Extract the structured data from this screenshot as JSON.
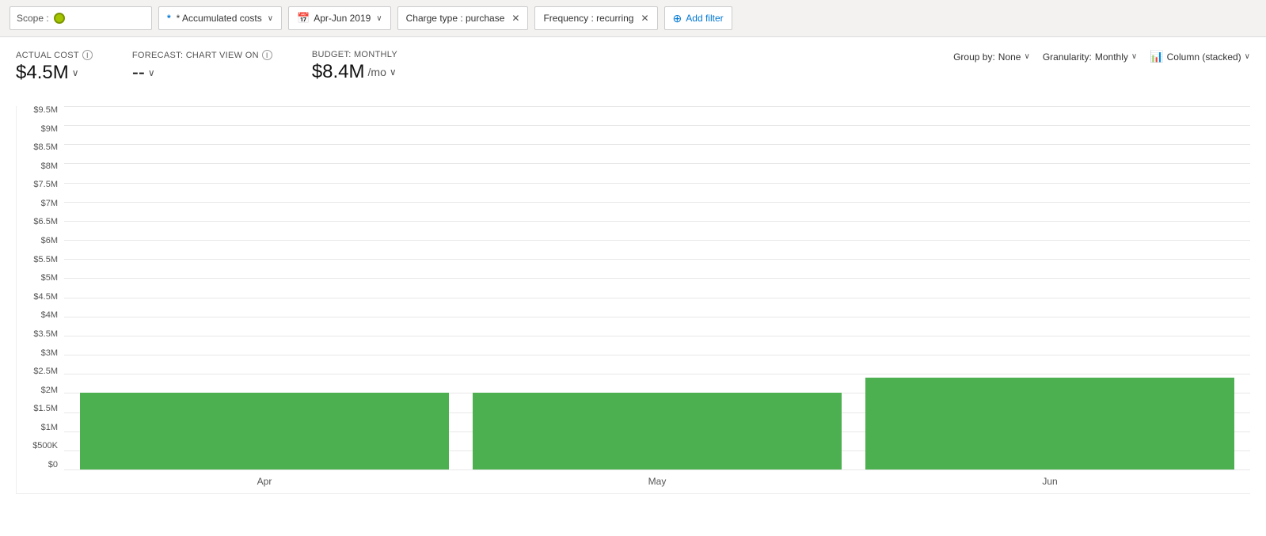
{
  "toolbar": {
    "scope_label": "Scope :",
    "scope_value": "",
    "accumulated_costs_label": "* Accumulated costs",
    "date_range_label": "Apr-Jun 2019",
    "charge_type_label": "Charge type : purchase",
    "frequency_label": "Frequency : recurring",
    "add_filter_label": "Add filter",
    "calendar_icon": "📅"
  },
  "metrics": {
    "actual_cost": {
      "label": "ACTUAL COST",
      "value": "$4.5M",
      "chevron": "∨"
    },
    "forecast": {
      "label": "FORECAST: CHART VIEW ON",
      "value": "--",
      "chevron": "∨"
    },
    "budget": {
      "label": "BUDGET: MONTHLY",
      "value": "$8.4M",
      "suffix": "/mo",
      "chevron": "∨"
    }
  },
  "chart_controls": {
    "group_by_label": "Group by:",
    "group_by_value": "None",
    "granularity_label": "Granularity:",
    "granularity_value": "Monthly",
    "view_label": "Column (stacked)"
  },
  "chart": {
    "y_axis": [
      "$9.5M",
      "$9M",
      "$8.5M",
      "$8M",
      "$7.5M",
      "$7M",
      "$6.5M",
      "$6M",
      "$5.5M",
      "$5M",
      "$4.5M",
      "$4M",
      "$3.5M",
      "$3M",
      "$2.5M",
      "$2M",
      "$1.5M",
      "$1M",
      "$500K",
      "$0"
    ],
    "bars": [
      {
        "label": "Apr",
        "value": 2.0,
        "height_pct": 21.0
      },
      {
        "label": "May",
        "value": 2.0,
        "height_pct": 21.0
      },
      {
        "label": "Jun",
        "value": 2.4,
        "height_pct": 25.2
      }
    ],
    "bar_color": "#4caf50",
    "max_value": 9.5
  }
}
